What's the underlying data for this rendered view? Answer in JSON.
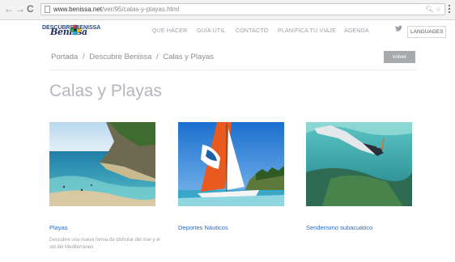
{
  "browser": {
    "url_domain": "www.benissa.net",
    "url_path": "/ver/95/calas-y-playas.html"
  },
  "header": {
    "logo_text": "Benissa",
    "nav": [
      {
        "label": "DESCUBRE BENISSA"
      },
      {
        "label": "QUÉ HACER"
      },
      {
        "label": "GUÍA ÚTIL"
      },
      {
        "label": "CONTACTO"
      },
      {
        "label": "PLANIFICA TU VIAJE"
      },
      {
        "label": "AGENDA"
      }
    ],
    "languages_label": "LANGUAGES"
  },
  "breadcrumb": {
    "items": [
      "Portada",
      "Descubre Benissa",
      "Calas y Playas"
    ],
    "separator": "/"
  },
  "back_button_label": "volver",
  "page_title": "Calas y Playas",
  "cards": [
    {
      "title": "Playas",
      "description": "Descubre una nueva forma de disfrutar del mar y el sol del Mediterráneo"
    },
    {
      "title": "Deportes Náuticos",
      "description": ""
    },
    {
      "title": "Senderismo subacuático",
      "description": ""
    }
  ],
  "colors": {
    "link": "#2c6bbf",
    "title_gray": "#b3b7bc",
    "button_gray": "#a7aaad",
    "logo_navy": "#1f2f5c"
  },
  "icons": [
    "back-arrow-icon",
    "forward-arrow-icon",
    "reload-icon",
    "page-icon",
    "zoom-icon",
    "star-icon",
    "menu-icon",
    "twitter-icon",
    "logo-flower-icon"
  ]
}
